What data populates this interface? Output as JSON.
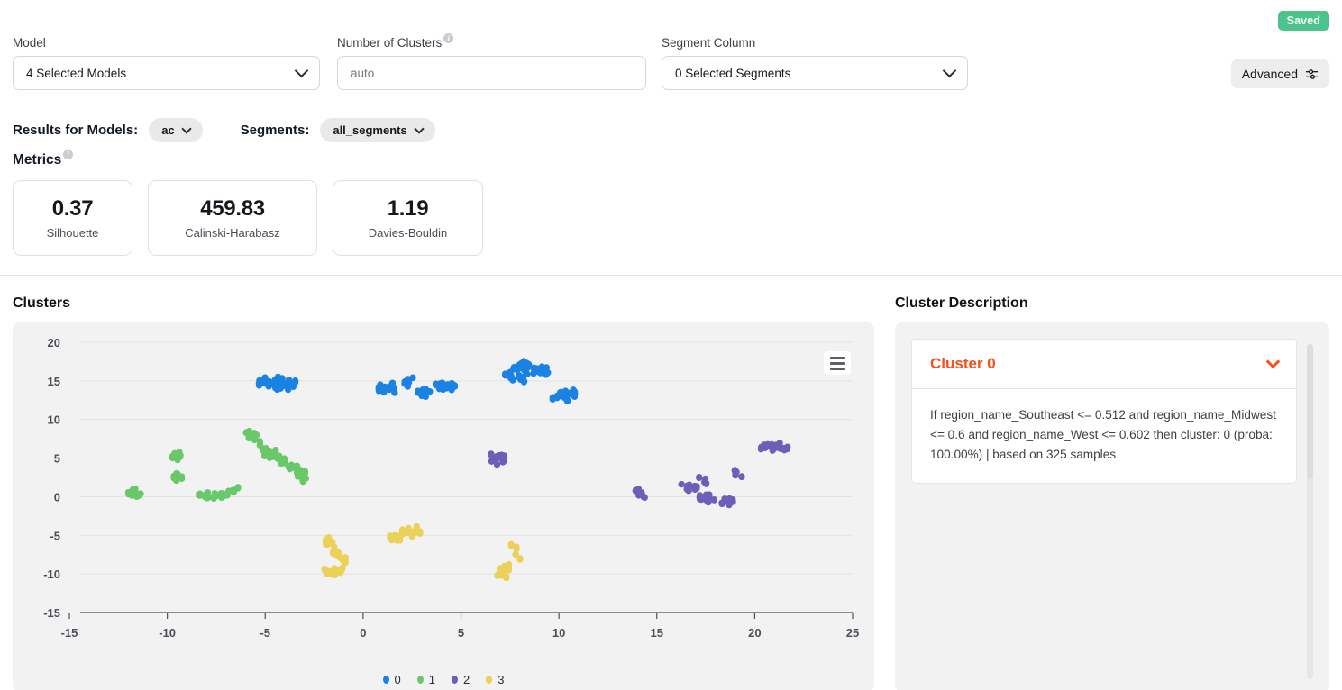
{
  "status_badge": {
    "label": "Saved",
    "color": "#4CC38A"
  },
  "config": {
    "model": {
      "label": "Model",
      "value": "4 Selected Models",
      "icon": "chevron-down-icon"
    },
    "num_clusters": {
      "label": "Number of Clusters",
      "placeholder": "auto",
      "value": "",
      "info_icon": "info-icon"
    },
    "segment_column": {
      "label": "Segment Column",
      "value": "0 Selected Segments",
      "icon": "chevron-down-icon"
    },
    "advanced": {
      "label": "Advanced",
      "icon": "sliders-icon"
    }
  },
  "results": {
    "models_label": "Results for Models:",
    "models_value": "ac",
    "segments_label": "Segments:",
    "segments_value": "all_segments"
  },
  "metrics": {
    "title": "Metrics",
    "cards": [
      {
        "value": "0.37",
        "label": "Silhouette"
      },
      {
        "value": "459.83",
        "label": "Calinski-Harabasz"
      },
      {
        "value": "1.19",
        "label": "Davies-Bouldin"
      }
    ]
  },
  "clusters_panel": {
    "title": "Clusters",
    "menu_icon": "hamburger-menu-icon"
  },
  "description_panel": {
    "title": "Cluster Description",
    "accordion": {
      "title": "Cluster 0",
      "title_color": "#f4511e",
      "chevron_icon": "chevron-down-icon",
      "body": "If region_name_Southeast <= 0.512 and region_name_Midwest <= 0.6 and region_name_West <= 0.602 then cluster: 0 (proba: 100.00%) | based on 325 samples"
    }
  },
  "chart_data": {
    "type": "scatter",
    "title": "Clusters",
    "xlabel": "",
    "ylabel": "",
    "xlim": [
      -15,
      25
    ],
    "ylim": [
      -15,
      20
    ],
    "xticks": [
      -15,
      -10,
      -5,
      0,
      5,
      10,
      15,
      20,
      25
    ],
    "yticks": [
      20,
      15,
      10,
      5,
      0,
      -5,
      -10,
      -15
    ],
    "grid": "horizontal",
    "legend_position": "bottom",
    "background": "#f2f2f3",
    "series": [
      {
        "name": "0",
        "color": "#1a82e2",
        "points": [
          [
            -5.3,
            14.7
          ],
          [
            -5.1,
            14.9
          ],
          [
            -4.9,
            15.1
          ],
          [
            -4.8,
            14.6
          ],
          [
            -4.6,
            14.4
          ],
          [
            -4.5,
            14.9
          ],
          [
            -4.4,
            15.2
          ],
          [
            -4.3,
            14.2
          ],
          [
            -4.2,
            14.8
          ],
          [
            -4.1,
            14.3
          ],
          [
            -4.0,
            15.0
          ],
          [
            -3.9,
            14.5
          ],
          [
            -3.8,
            14.9
          ],
          [
            -3.7,
            14.1
          ],
          [
            -3.6,
            14.7
          ],
          [
            0.8,
            14.0
          ],
          [
            1.0,
            14.2
          ],
          [
            1.2,
            13.9
          ],
          [
            1.4,
            14.1
          ],
          [
            1.6,
            13.8
          ],
          [
            1.5,
            14.4
          ],
          [
            2.2,
            14.9
          ],
          [
            2.4,
            15.1
          ],
          [
            2.3,
            14.6
          ],
          [
            2.9,
            13.4
          ],
          [
            3.1,
            13.6
          ],
          [
            3.3,
            13.3
          ],
          [
            3.2,
            13.8
          ],
          [
            3.8,
            14.3
          ],
          [
            4.0,
            14.5
          ],
          [
            4.2,
            14.2
          ],
          [
            4.4,
            14.4
          ],
          [
            4.6,
            14.1
          ],
          [
            7.6,
            16.4
          ],
          [
            7.8,
            16.7
          ],
          [
            8.0,
            16.9
          ],
          [
            8.2,
            16.6
          ],
          [
            8.4,
            17.0
          ],
          [
            8.6,
            16.8
          ],
          [
            8.1,
            17.2
          ],
          [
            8.3,
            16.2
          ],
          [
            7.4,
            15.6
          ],
          [
            7.6,
            15.4
          ],
          [
            8.0,
            15.5
          ],
          [
            8.2,
            15.2
          ],
          [
            8.8,
            16.3
          ],
          [
            9.0,
            16.5
          ],
          [
            9.2,
            16.1
          ],
          [
            9.4,
            16.4
          ],
          [
            9.8,
            12.9
          ],
          [
            10.0,
            13.2
          ],
          [
            10.2,
            13.4
          ],
          [
            10.4,
            13.1
          ],
          [
            10.6,
            13.5
          ],
          [
            10.3,
            12.7
          ],
          [
            10.8,
            13.3
          ]
        ]
      },
      {
        "name": "1",
        "color": "#68c86a",
        "points": [
          [
            -11.8,
            0.6
          ],
          [
            -11.6,
            0.4
          ],
          [
            -11.7,
            0.2
          ],
          [
            -11.5,
            0.7
          ],
          [
            -11.9,
            0.3
          ],
          [
            -9.6,
            5.3
          ],
          [
            -9.4,
            5.1
          ],
          [
            -9.5,
            5.5
          ],
          [
            -9.6,
            2.6
          ],
          [
            -9.4,
            2.4
          ],
          [
            -9.5,
            2.8
          ],
          [
            -8.2,
            0.1
          ],
          [
            -8.0,
            0.0
          ],
          [
            -7.8,
            0.2
          ],
          [
            -7.6,
            0.1
          ],
          [
            -7.4,
            0.3
          ],
          [
            -7.2,
            0.2
          ],
          [
            -7.0,
            0.4
          ],
          [
            -6.8,
            0.5
          ],
          [
            -6.5,
            0.9
          ],
          [
            -5.9,
            8.0
          ],
          [
            -5.7,
            7.9
          ],
          [
            -5.5,
            7.7
          ],
          [
            -5.8,
            8.3
          ],
          [
            -5.4,
            7.4
          ],
          [
            -5.2,
            6.4
          ],
          [
            -5.0,
            6.0
          ],
          [
            -4.9,
            5.6
          ],
          [
            -4.7,
            5.3
          ],
          [
            -4.6,
            5.8
          ],
          [
            -4.4,
            5.4
          ],
          [
            -4.3,
            5.0
          ],
          [
            -4.1,
            4.6
          ],
          [
            -3.9,
            4.2
          ],
          [
            -3.7,
            3.9
          ],
          [
            -3.5,
            3.4
          ],
          [
            -3.3,
            3.7
          ],
          [
            -3.1,
            3.0
          ],
          [
            -3.0,
            2.7
          ],
          [
            -3.2,
            2.3
          ]
        ]
      },
      {
        "name": "2",
        "color": "#6d5fb8",
        "points": [
          [
            6.7,
            4.9
          ],
          [
            6.9,
            5.1
          ],
          [
            7.1,
            4.8
          ],
          [
            6.8,
            4.5
          ],
          [
            7.0,
            5.3
          ],
          [
            7.2,
            5.0
          ],
          [
            6.6,
            5.2
          ],
          [
            14.0,
            0.5
          ],
          [
            14.2,
            0.3
          ],
          [
            14.1,
            0.7
          ],
          [
            14.3,
            0.2
          ],
          [
            16.4,
            1.3
          ],
          [
            16.6,
            1.1
          ],
          [
            16.8,
            1.4
          ],
          [
            17.0,
            1.2
          ],
          [
            17.3,
            2.2
          ],
          [
            17.5,
            2.0
          ],
          [
            17.2,
            0.0
          ],
          [
            17.4,
            -0.2
          ],
          [
            17.6,
            0.2
          ],
          [
            17.8,
            -0.1
          ],
          [
            17.5,
            -0.4
          ],
          [
            18.4,
            -0.6
          ],
          [
            18.6,
            -0.8
          ],
          [
            18.8,
            -0.5
          ],
          [
            19.0,
            3.1
          ],
          [
            19.2,
            2.9
          ],
          [
            20.4,
            6.4
          ],
          [
            20.6,
            6.6
          ],
          [
            20.8,
            6.3
          ],
          [
            21.0,
            6.5
          ],
          [
            21.2,
            6.4
          ],
          [
            21.4,
            6.6
          ],
          [
            21.6,
            6.3
          ]
        ]
      },
      {
        "name": "3",
        "color": "#ecd159",
        "points": [
          [
            -1.9,
            -5.9
          ],
          [
            -1.7,
            -6.1
          ],
          [
            -1.8,
            -5.6
          ],
          [
            -1.6,
            -6.3
          ],
          [
            -1.5,
            -7.1
          ],
          [
            -1.3,
            -7.5
          ],
          [
            -1.1,
            -7.9
          ],
          [
            -0.9,
            -8.2
          ],
          [
            -1.9,
            -9.7
          ],
          [
            -1.7,
            -9.9
          ],
          [
            -1.5,
            -9.6
          ],
          [
            -1.3,
            -9.8
          ],
          [
            -1.1,
            -9.5
          ],
          [
            2.0,
            -4.6
          ],
          [
            2.2,
            -4.4
          ],
          [
            2.4,
            -4.8
          ],
          [
            2.6,
            -4.2
          ],
          [
            2.8,
            -4.5
          ],
          [
            1.6,
            -5.4
          ],
          [
            1.8,
            -5.6
          ],
          [
            1.5,
            -5.1
          ],
          [
            7.7,
            -6.5
          ],
          [
            7.9,
            -7.8
          ],
          [
            7.1,
            -9.3
          ],
          [
            7.3,
            -9.6
          ],
          [
            7.0,
            -9.9
          ],
          [
            7.2,
            -10.2
          ],
          [
            7.4,
            -9.1
          ]
        ]
      }
    ]
  }
}
